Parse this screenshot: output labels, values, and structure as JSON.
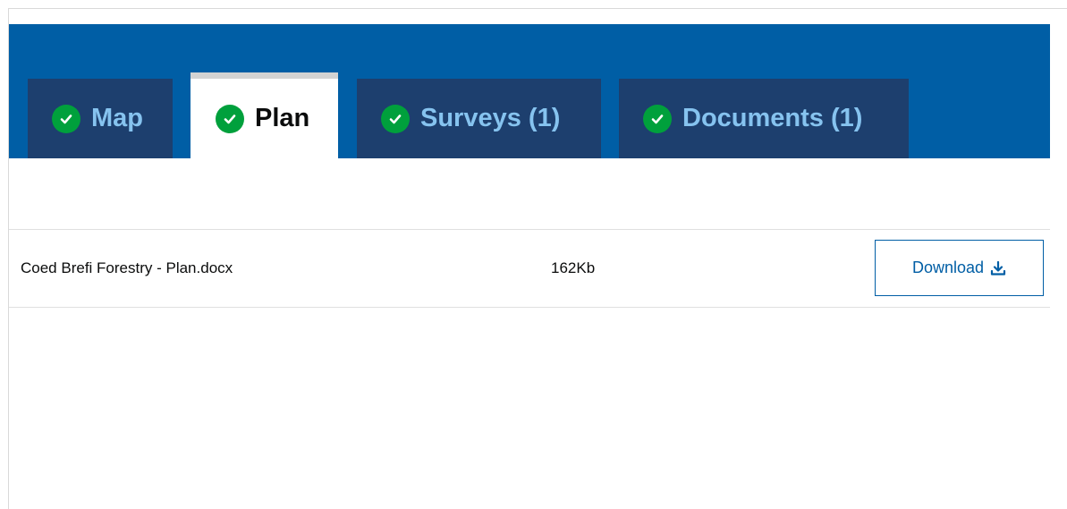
{
  "tabs": [
    {
      "label": "Map",
      "active": false,
      "status": "complete"
    },
    {
      "label": "Plan",
      "active": true,
      "status": "complete"
    },
    {
      "label": "Surveys (1)",
      "active": false,
      "status": "complete"
    },
    {
      "label": "Documents (1)",
      "active": false,
      "status": "complete"
    }
  ],
  "files": [
    {
      "name": "Coed Brefi Forestry - Plan.docx",
      "size": "162Kb",
      "action_label": "Download",
      "action_icon": "download-icon"
    }
  ],
  "colors": {
    "tab_bar": "#005ea5",
    "tab_inactive": "#1d3f6e",
    "tab_inactive_text": "#86c3ef",
    "tab_active": "#ffffff",
    "check_green": "#00a03c",
    "link_blue": "#005ea5"
  },
  "icons": {
    "tab_status": "check-circle-icon",
    "download": "download-icon"
  }
}
